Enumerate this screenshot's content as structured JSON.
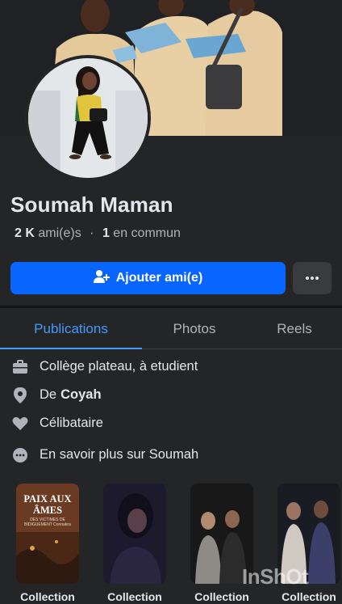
{
  "profile": {
    "name": "Soumah Maman",
    "friends_count": "2 K",
    "friends_label": "ami(e)s",
    "mutual_count": "1",
    "mutual_label": "en commun"
  },
  "actions": {
    "add_friend_label": "Ajouter ami(e)",
    "more_label": "···"
  },
  "tabs": [
    {
      "label": "Publications",
      "active": true
    },
    {
      "label": "Photos",
      "active": false
    },
    {
      "label": "Reels",
      "active": false
    }
  ],
  "intro": {
    "work": "Collège plateau, à etudient",
    "from_prefix": "De",
    "from_place": "Coyah",
    "relationship": "Célibataire",
    "more": "En savoir plus sur Soumah"
  },
  "collections": [
    {
      "label": "Collection",
      "book_title": "PAIX AUX ÂMES",
      "book_subtitle": "DES VICTIMES DE BIDIGUEMENT Connakra"
    },
    {
      "label": "Collection"
    },
    {
      "label": "Collection"
    },
    {
      "label": "Collection"
    }
  ],
  "watermark": "InShOt",
  "icons": {
    "work": "briefcase-icon",
    "from": "location-pin-icon",
    "relationship": "heart-icon",
    "more": "more-dots-icon",
    "add_friend": "add-person-icon"
  },
  "colors": {
    "background": "#242526",
    "primary": "#0866ff",
    "tab_active": "#4599ff",
    "text": "#e4e6eb",
    "secondary_text": "#b0b3b8"
  }
}
